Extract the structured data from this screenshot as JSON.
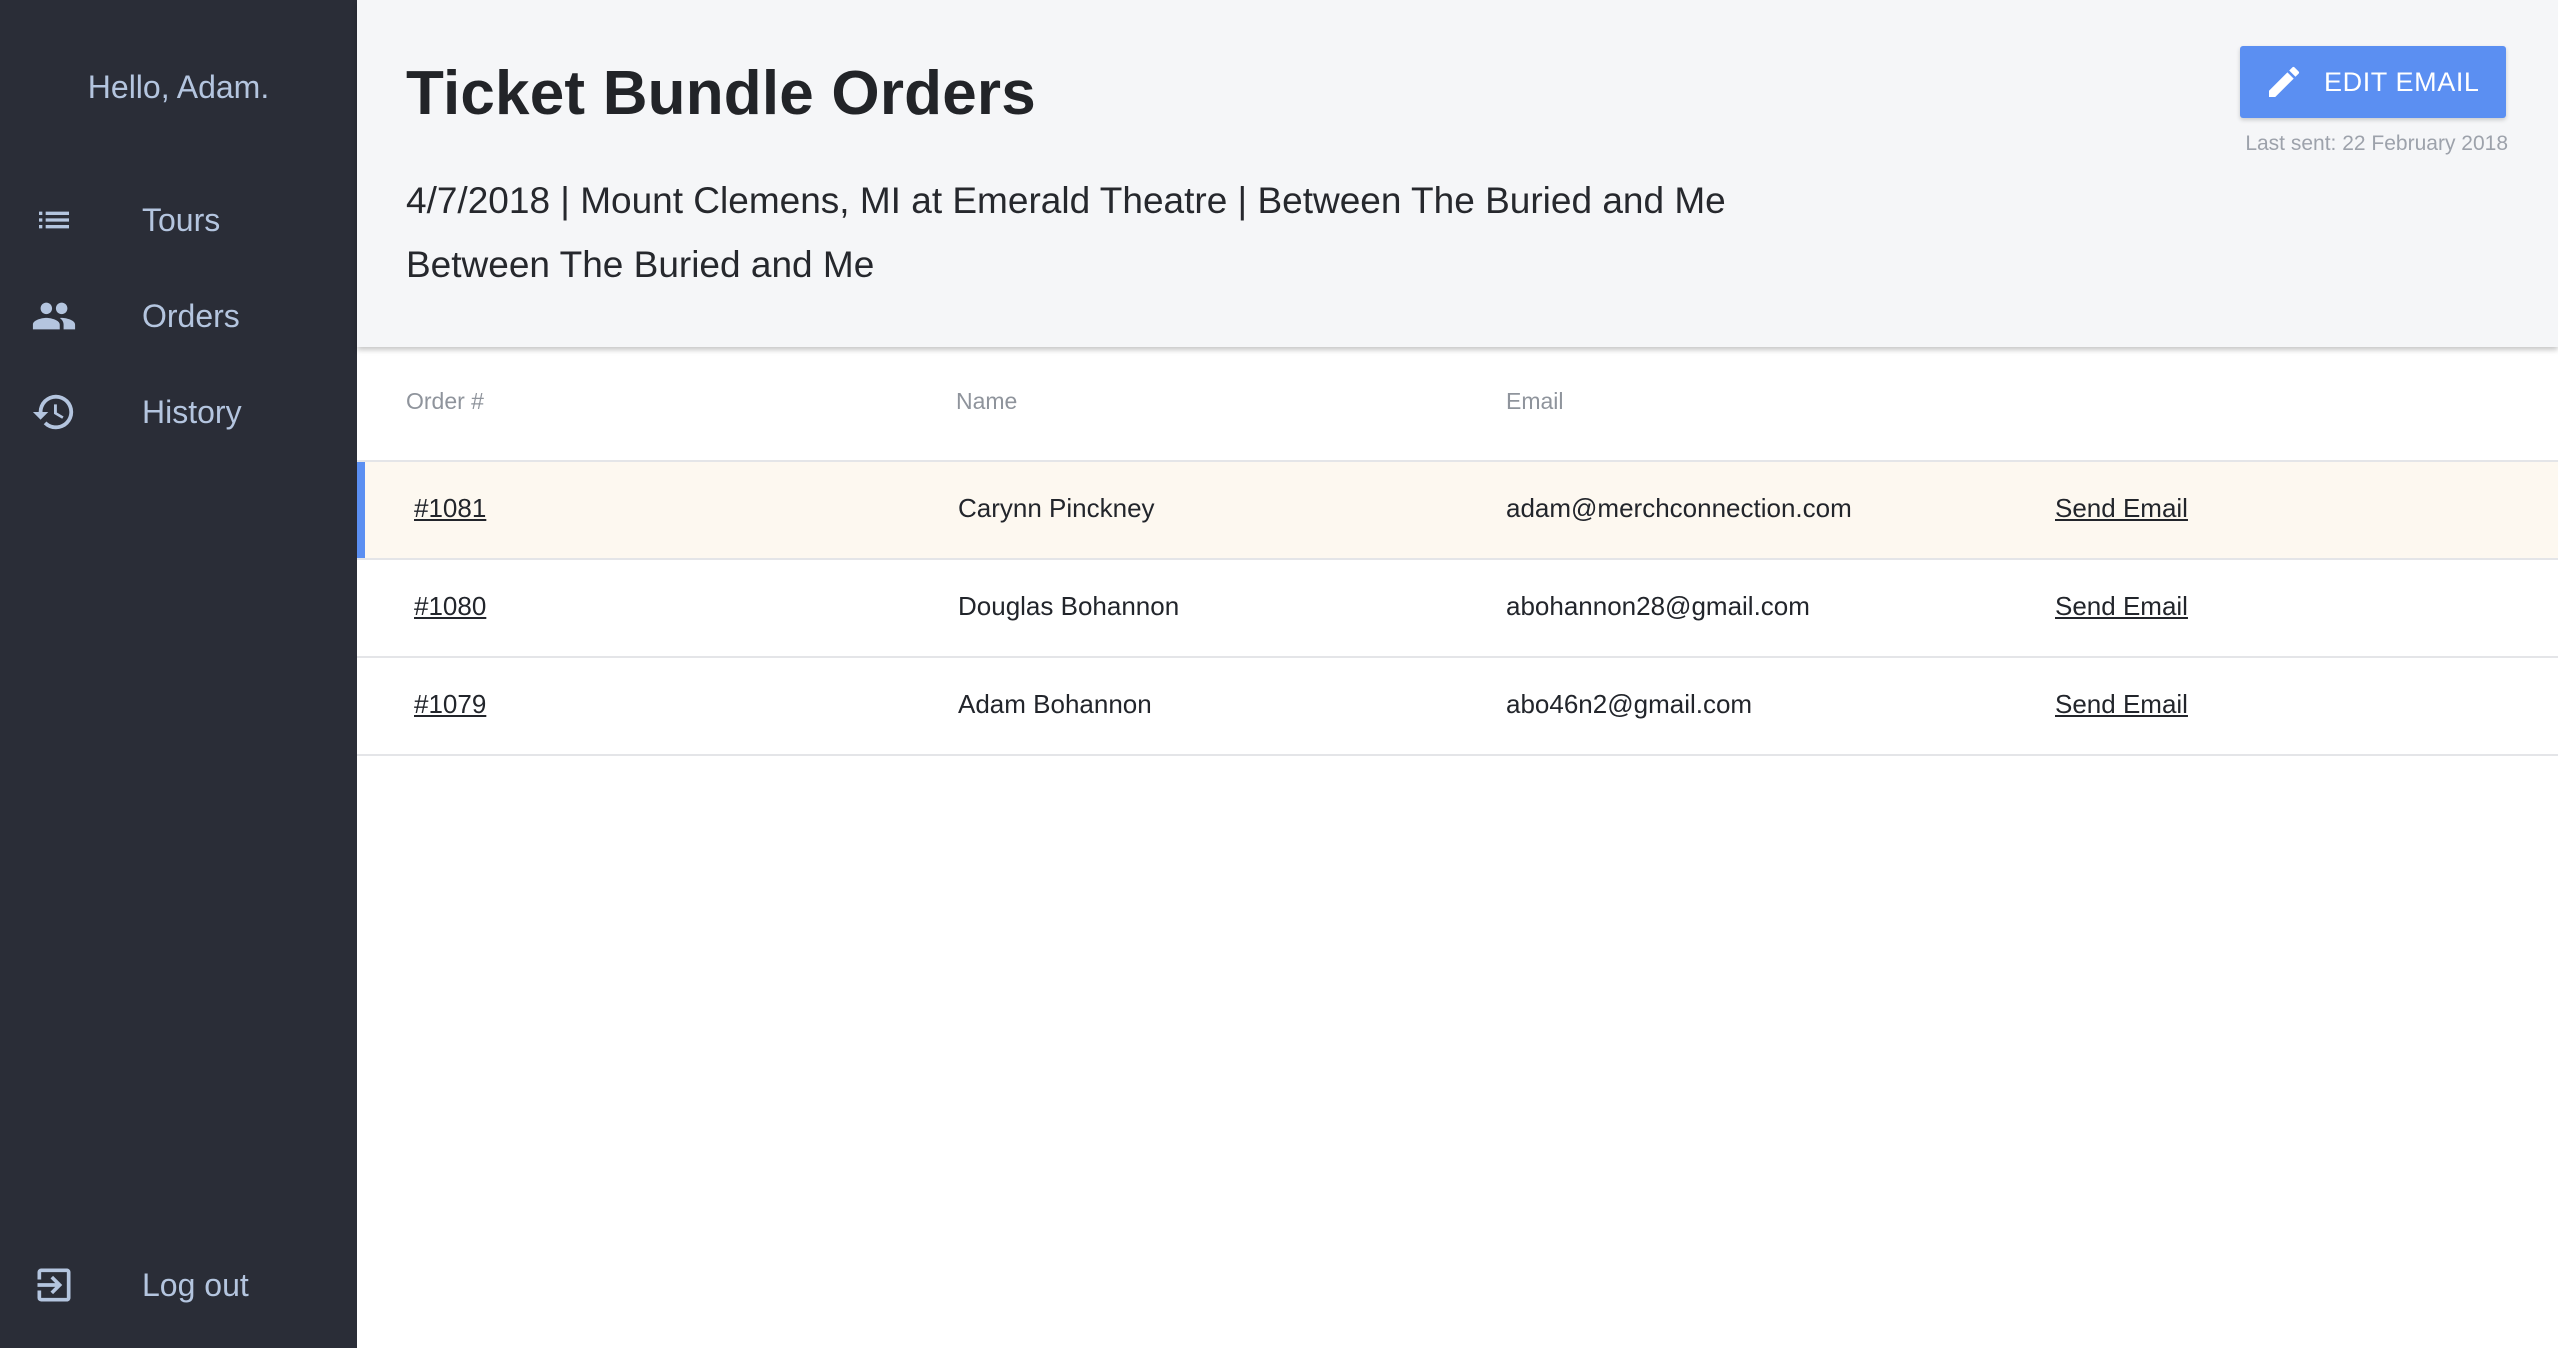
{
  "sidebar": {
    "greeting": "Hello, Adam.",
    "items": [
      {
        "label": "Tours",
        "icon": "list-icon"
      },
      {
        "label": "Orders",
        "icon": "people-icon"
      },
      {
        "label": "History",
        "icon": "history-icon"
      }
    ],
    "logout": {
      "label": "Log out",
      "icon": "logout-icon"
    }
  },
  "header": {
    "title": "Ticket Bundle Orders",
    "subtitle_line1": "4/7/2018 | Mount Clemens, MI at Emerald Theatre | Between The Buried and Me",
    "subtitle_line2": "Between The Buried and Me",
    "edit_button": {
      "label": "EDIT EMAIL",
      "icon": "pencil-icon"
    },
    "last_sent": "Last sent: 22 February 2018"
  },
  "table": {
    "columns": [
      "Order #",
      "Name",
      "Email"
    ],
    "rows": [
      {
        "order": "#1081",
        "name": "Carynn Pinckney",
        "email": "adam@merchconnection.com",
        "action": "Send Email",
        "selected": true
      },
      {
        "order": "#1080",
        "name": "Douglas Bohannon",
        "email": "abohannon28@gmail.com",
        "action": "Send Email",
        "selected": false
      },
      {
        "order": "#1079",
        "name": "Adam Bohannon",
        "email": "abo46n2@gmail.com",
        "action": "Send Email",
        "selected": false
      }
    ]
  },
  "colors": {
    "sidebar_bg": "#2a2d37",
    "sidebar_text": "#b4c5df",
    "accent": "#5b8ff2",
    "selected_row_bg": "#fdf8f0"
  }
}
